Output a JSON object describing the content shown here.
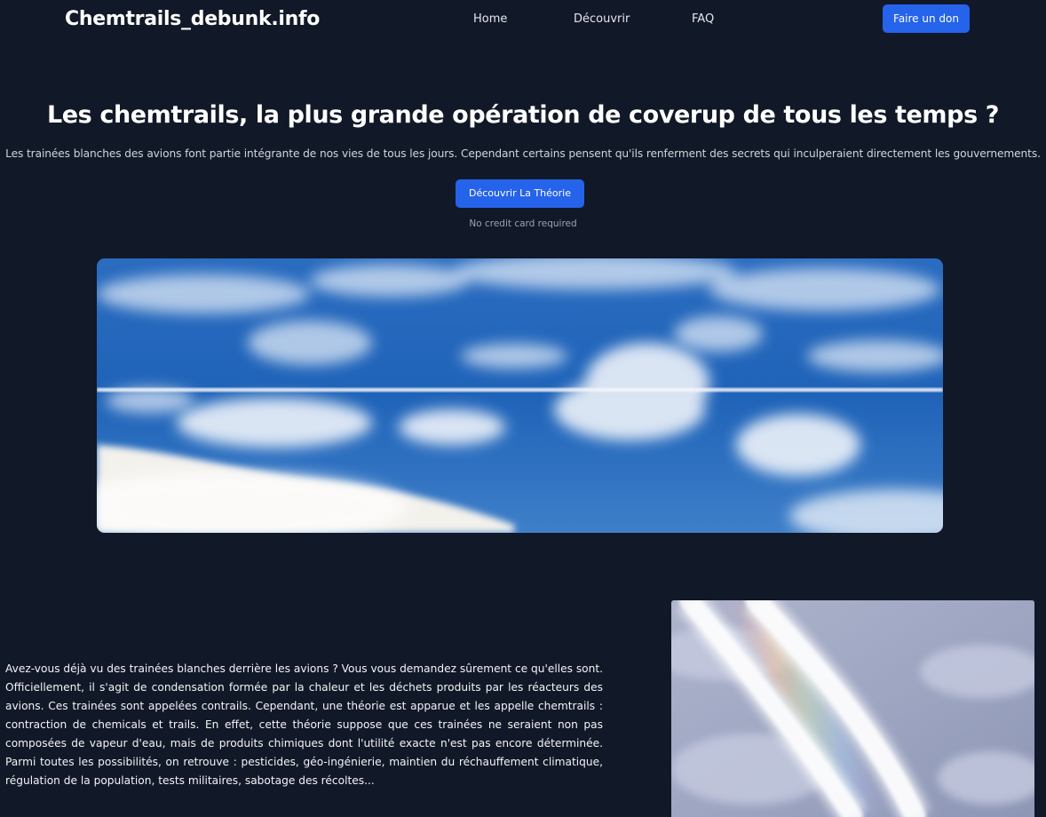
{
  "header": {
    "logo": "Chemtrails_debunk.info",
    "nav": {
      "home": "Home",
      "decouvrir": "Découvrir",
      "faq": "FAQ"
    },
    "donate_label": "Faire un don"
  },
  "hero": {
    "title": "Les chemtrails, la plus grande opération de coverup de tous les temps ?",
    "subtitle": "Les trainées blanches des avions font partie intégrante de nos vies de tous les jours. Cependant certains pensent qu'ils renferment des secrets qui inculperaient directement les gouvernements.",
    "cta_label": "Découvrir La Théorie",
    "cta_note": "No credit card required"
  },
  "article": {
    "paragraph": "Avez-vous déjà vu des trainées blanches derrière les avions ? Vous vous demandez sûrement ce qu'elles sont. Officiellement, il s'agit de condensation formée par la chaleur et les déchets produits par les réacteurs des avions. Ces trainées sont appelées contrails. Cependant, une théorie est apparue et les appelle chemtrails : contraction de chemicals et trails. En effet, cette théorie suppose que ces trainées ne seraient non pas composées de vapeur d'eau, mais de produits chimiques dont l'utilité exacte n'est pas encore déterminée. Parmi toutes les possibilités, on retrouve : pesticides, géo-ingénierie, maintien du réchauffement climatique, régulation de la population, tests militaires, sabotage des récoltes..."
  },
  "colors": {
    "background": "#111827",
    "accent": "#2563eb",
    "sky_blue": "#1e5fb5",
    "muted_text": "#9ca3af"
  },
  "images": {
    "hero": "sky-contrail-photo",
    "side": "crossing-contrails-photo"
  }
}
